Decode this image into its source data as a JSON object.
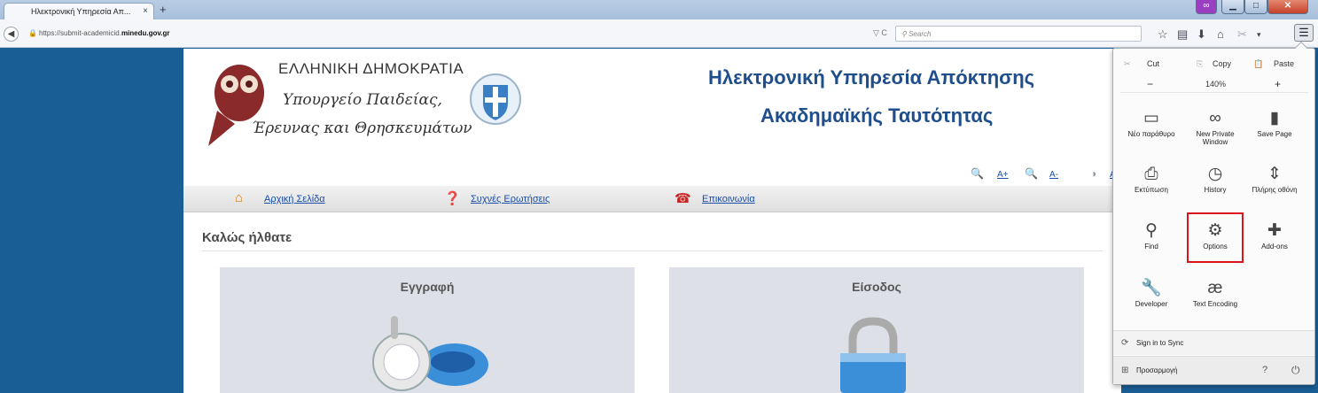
{
  "browser": {
    "tab_title": "Ηλεκτρονική Υπηρεσία Απ...",
    "tab_close": "×",
    "new_tab": "+",
    "url_prefix": "https://submit-academicid.",
    "url_domain": "minedu.gov.gr",
    "search_placeholder": "Search",
    "url_tools": "▽ C",
    "mask_icon": "∞",
    "minimize": "▁",
    "maximize": "□",
    "close": "✕"
  },
  "page": {
    "gov_name": "ΕΛΛΗΝΙΚΗ ΔΗΜΟΚΡΑΤΙΑ",
    "ministry_line1": "Υπουργείο Παιδείας,",
    "ministry_line2": "Έρευνας και Θρησκευμάτων",
    "service_title_1": "Ηλεκτρονική Υπηρεσία Απόκτησης",
    "service_title_2": "Ακαδημαϊκής Ταυτότητας",
    "font_increase": "A+",
    "font_decrease": "A-",
    "contrast": "A",
    "nav": {
      "home": "Αρχική Σελίδα",
      "faq": "Συχνές Ερωτήσεις",
      "contact": "Επικοινωνία"
    },
    "welcome": "Καλώς ήλθατε",
    "register_title": "Εγγραφή",
    "login_title": "Είσοδος"
  },
  "ff_menu": {
    "cut": "Cut",
    "copy": "Copy",
    "paste": "Paste",
    "zoom_out": "−",
    "zoom_level": "140%",
    "zoom_in": "+",
    "new_window": "Νέο παράθυρο",
    "private_window": "New Private Window",
    "save_page": "Save Page",
    "print": "Εκτύπωση",
    "history": "History",
    "fullscreen": "Πλήρης οθόνη",
    "find": "Find",
    "options": "Options",
    "addons": "Add-ons",
    "developer": "Developer",
    "text_encoding": "Text Encoding",
    "sync": "Sign in to Sync",
    "customize": "Προσαρμογή"
  },
  "colors": {
    "page_background": "#1a5e96",
    "title_blue": "#1f4e8c",
    "link_blue": "#1a4ea8",
    "options_highlight": "#d9141a"
  }
}
